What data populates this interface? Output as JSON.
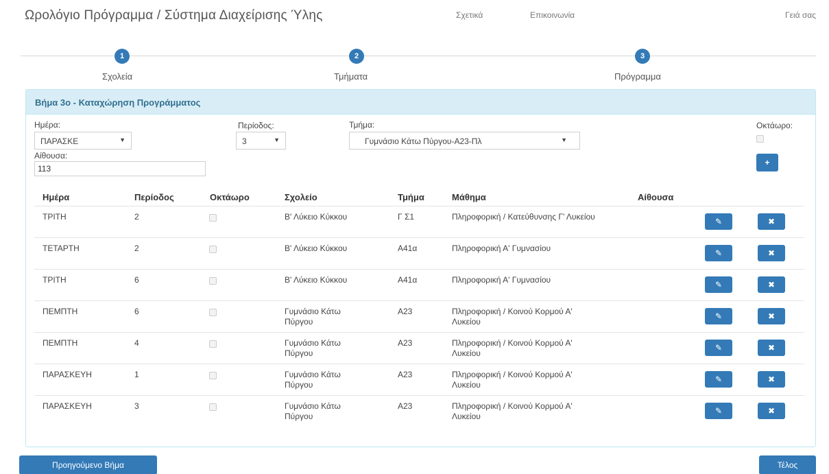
{
  "navbar": {
    "brand": "Ωρολόγιο Πρόγραμμα / Σύστημα Διαχείρισης Ύλης",
    "about": "Σχετικά",
    "contact": "Επικοινωνία",
    "hello": "Γειά σας"
  },
  "wizard": {
    "steps": [
      {
        "number": "1",
        "label": "Σχολεία"
      },
      {
        "number": "2",
        "label": "Τμήματα"
      },
      {
        "number": "3",
        "label": "Πρόγραμμα"
      }
    ]
  },
  "panel": {
    "title": "Βήμα 3ο - Καταχώρηση Προγράμματος",
    "form": {
      "day_label": "Ημέρα:",
      "day_value": "ΠΑΡΑΣΚΕ",
      "period_label": "Περίοδος:",
      "period_value": "3",
      "section_label": "Τμήμα:",
      "section_value": "Γυμνάσιο Κάτω Πύργου-Α23-Πλ",
      "eight_label": "Οκτάωρο:",
      "room_label": "Αίθουσα:",
      "room_value": "113",
      "add_label": "+"
    },
    "table": {
      "headers": [
        "Ημέρα",
        "Περίοδος",
        "Οκτάωρο",
        "Σχολείο",
        "Τμήμα",
        "Μάθημα",
        "Αίθουσα"
      ],
      "rows": [
        {
          "day": "ΤΡΙΤΗ",
          "period": "2",
          "school": "Β' Λύκειο Κύκκου",
          "section": "Γ Σ1",
          "course": "Πληροφορική / Κατεύθυνσης Γ' Λυκείου",
          "room": ""
        },
        {
          "day": "ΤΕΤΑΡΤΗ",
          "period": "2",
          "school": "Β' Λύκειο Κύκκου",
          "section": "Α41α",
          "course": "Πληροφορική Α' Γυμνασίου",
          "room": ""
        },
        {
          "day": "ΤΡΙΤΗ",
          "period": "6",
          "school": "Β' Λύκειο Κύκκου",
          "section": "Α41α",
          "course": "Πληροφορική Α' Γυμνασίου",
          "room": ""
        },
        {
          "day": "ΠΕΜΠΤΗ",
          "period": "6",
          "school": "Γυμνάσιο Κάτω Πύργου",
          "section": "Α23",
          "course": "Πληροφορική / Κοινού Κορμού Α' Λυκείου",
          "room": ""
        },
        {
          "day": "ΠΕΜΠΤΗ",
          "period": "4",
          "school": "Γυμνάσιο Κάτω Πύργου",
          "section": "Α23",
          "course": "Πληροφορική / Κοινού Κορμού Α' Λυκείου",
          "room": ""
        },
        {
          "day": "ΠΑΡΑΣΚΕΥΗ",
          "period": "1",
          "school": "Γυμνάσιο Κάτω Πύργου",
          "section": "Α23",
          "course": "Πληροφορική / Κοινού Κορμού Α' Λυκείου",
          "room": ""
        },
        {
          "day": "ΠΑΡΑΣΚΕΥΗ",
          "period": "3",
          "school": "Γυμνάσιο Κάτω Πύργου",
          "section": "Α23",
          "course": "Πληροφορική / Κοινού Κορμού Α' Λυκείου",
          "room": ""
        }
      ],
      "edit_icon": "edit-icon",
      "delete_icon": "delete-icon"
    }
  },
  "footer": {
    "prev_label": "Προηγούμενο Βήμα",
    "finish_label": "Τέλος"
  },
  "colors": {
    "primary": "#337ab7",
    "panel_heading_bg": "#d9edf7",
    "panel_heading_text": "#31708f"
  }
}
